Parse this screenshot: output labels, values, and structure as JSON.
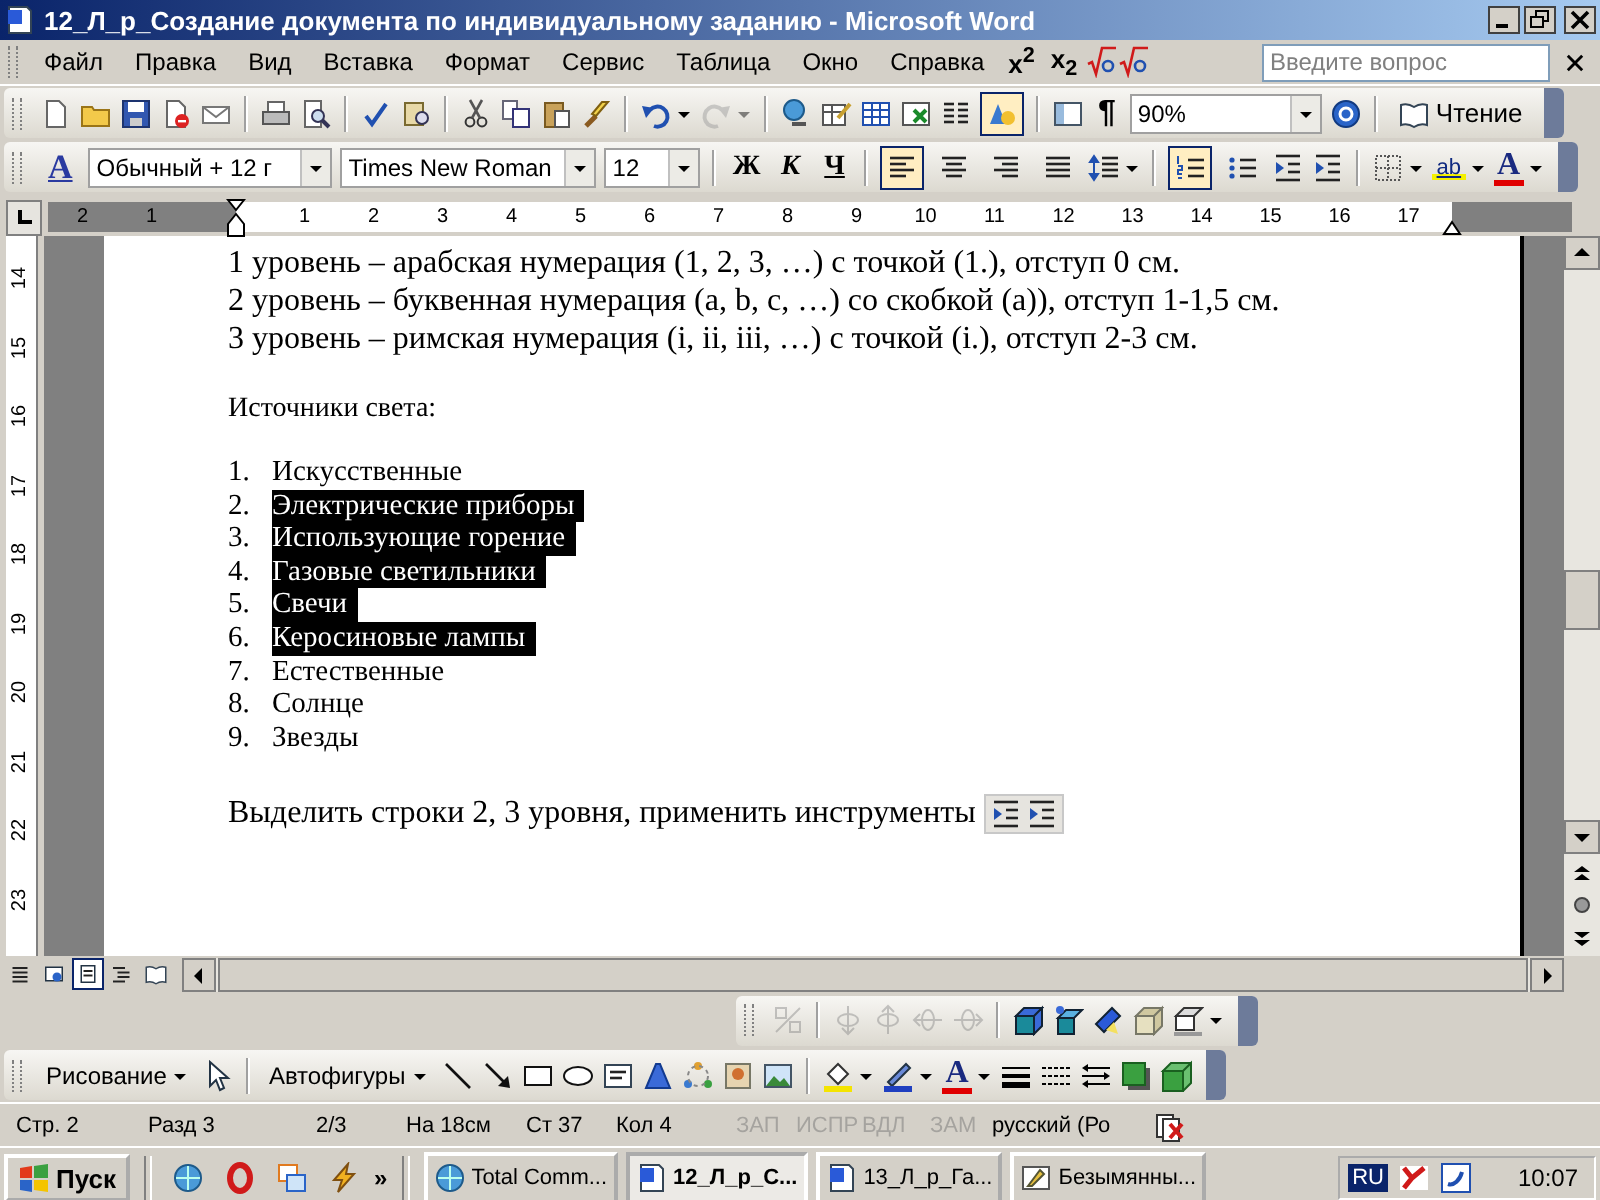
{
  "window": {
    "title": "12_Л_р_Создание документа по индивидуальному заданию - Microsoft Word"
  },
  "menu": {
    "items": [
      "Файл",
      "Правка",
      "Вид",
      "Вставка",
      "Формат",
      "Сервис",
      "Таблица",
      "Окно",
      "Справка"
    ],
    "script_buttons": [
      "x$^{2}$",
      "x$_{2}$"
    ],
    "question_box": {
      "placeholder": "Введите вопрос"
    }
  },
  "standard_toolbar": {
    "redo_disabled": true,
    "drawing_pressed": true,
    "show_marks": "¶",
    "zoom": "90%",
    "reading_button": "Чтение"
  },
  "formatting_toolbar": {
    "styles_button": "A",
    "style": "Обычный + 12 г",
    "font": "Times New Roman",
    "size": "12",
    "bold": "Ж",
    "italic": "К",
    "underline": "Ч",
    "alignment": [
      {
        "kind": "left",
        "selected": true
      },
      {
        "kind": "center",
        "selected": false
      },
      {
        "kind": "right",
        "selected": false
      },
      {
        "kind": "justify",
        "selected": false
      }
    ],
    "numbering_on": true,
    "bullets_on": false,
    "highlight_label": "ab",
    "font_color_label": "A"
  },
  "ruler": {
    "left_numbers": [
      "2",
      "1"
    ],
    "numbers": [
      "1",
      "2",
      "3",
      "4",
      "5",
      "6",
      "7",
      "8",
      "9",
      "10",
      "11",
      "12",
      "13",
      "14",
      "15",
      "16",
      "17"
    ]
  },
  "vertical_ruler": {
    "numbers": [
      "14",
      "15",
      "16",
      "17",
      "18",
      "19",
      "20",
      "21",
      "22",
      "23"
    ]
  },
  "document": {
    "level_lines": [
      "1 уровень – арабская нумерация (1, 2, 3, …) с точкой (1.), отступ 0 см.",
      "2 уровень – буквенная нумерация (a, b, c, …) со скобкой (a)), отступ 1-1,5 см.",
      "3 уровень – римская нумерация (i, ii, iii, …) с точкой (i.), отступ 2-3 см."
    ],
    "heading": "Источники света:",
    "list": [
      {
        "number": "1.",
        "text": "Искусственные",
        "selected": false
      },
      {
        "number": "2.",
        "text": "Электрические приборы",
        "selected": true
      },
      {
        "number": "3.",
        "text": "Использующие горение",
        "selected": true
      },
      {
        "number": "4.",
        "text": "Газовые светильники",
        "selected": true
      },
      {
        "number": "5.",
        "text": "Свечи",
        "selected": true
      },
      {
        "number": "6.",
        "text": "Керосиновые лампы",
        "selected": true
      },
      {
        "number": "7.",
        "text": "Естественные",
        "selected": false
      },
      {
        "number": "8.",
        "text": "Солнце",
        "selected": false
      },
      {
        "number": "9.",
        "text": "Звезды",
        "selected": false
      }
    ],
    "instruction": "Выделить строки 2, 3 уровня, применить инструменты"
  },
  "view_buttons": [
    {
      "kind": "normal",
      "selected": false
    },
    {
      "kind": "web",
      "selected": false
    },
    {
      "kind": "print",
      "selected": true
    },
    {
      "kind": "outline",
      "selected": false
    },
    {
      "kind": "reading",
      "selected": false
    }
  ],
  "three_d_toolbar": [
    {
      "kind": "toggle",
      "disabled": true
    },
    {
      "kind": "tilt-down",
      "disabled": true
    },
    {
      "kind": "tilt-up",
      "disabled": true
    },
    {
      "kind": "tilt-left",
      "disabled": true
    },
    {
      "kind": "tilt-right",
      "disabled": true
    },
    {
      "kind": "depth",
      "disabled": false
    },
    {
      "kind": "direction",
      "disabled": false
    },
    {
      "kind": "lighting",
      "disabled": false
    },
    {
      "kind": "surface",
      "disabled": false
    },
    {
      "kind": "color",
      "disabled": false
    }
  ],
  "drawing_toolbar": {
    "draw_menu": "Рисование",
    "autoshapes_menu": "Автофигуры",
    "font_color_label": "A"
  },
  "status_bar": [
    {
      "text": "Стр. 2",
      "disabled": false
    },
    {
      "text": "Разд 3",
      "disabled": false
    },
    {
      "text": "2/3",
      "disabled": false
    },
    {
      "text": "На 18см",
      "disabled": false
    },
    {
      "text": "Ст 37",
      "disabled": false
    },
    {
      "text": "Кол 4",
      "disabled": false
    },
    {
      "text": "ЗАП",
      "disabled": true
    },
    {
      "text": "ИСПР",
      "disabled": true
    },
    {
      "text": "ВДЛ",
      "disabled": true
    },
    {
      "text": "ЗАМ",
      "disabled": true
    },
    {
      "text": "русский (Ро",
      "disabled": false
    }
  ],
  "taskbar": {
    "start": "Пуск",
    "more": "»",
    "tasks": [
      {
        "kind": "commander",
        "label": "Total Comm...",
        "selected": false
      },
      {
        "kind": "word",
        "label": "12_Л_р_С...",
        "selected": true
      },
      {
        "kind": "word",
        "label": "13_Л_р_Га...",
        "selected": false
      },
      {
        "kind": "paint",
        "label": "Безымянны...",
        "selected": false
      }
    ],
    "language": "RU",
    "clock": "10:07"
  }
}
